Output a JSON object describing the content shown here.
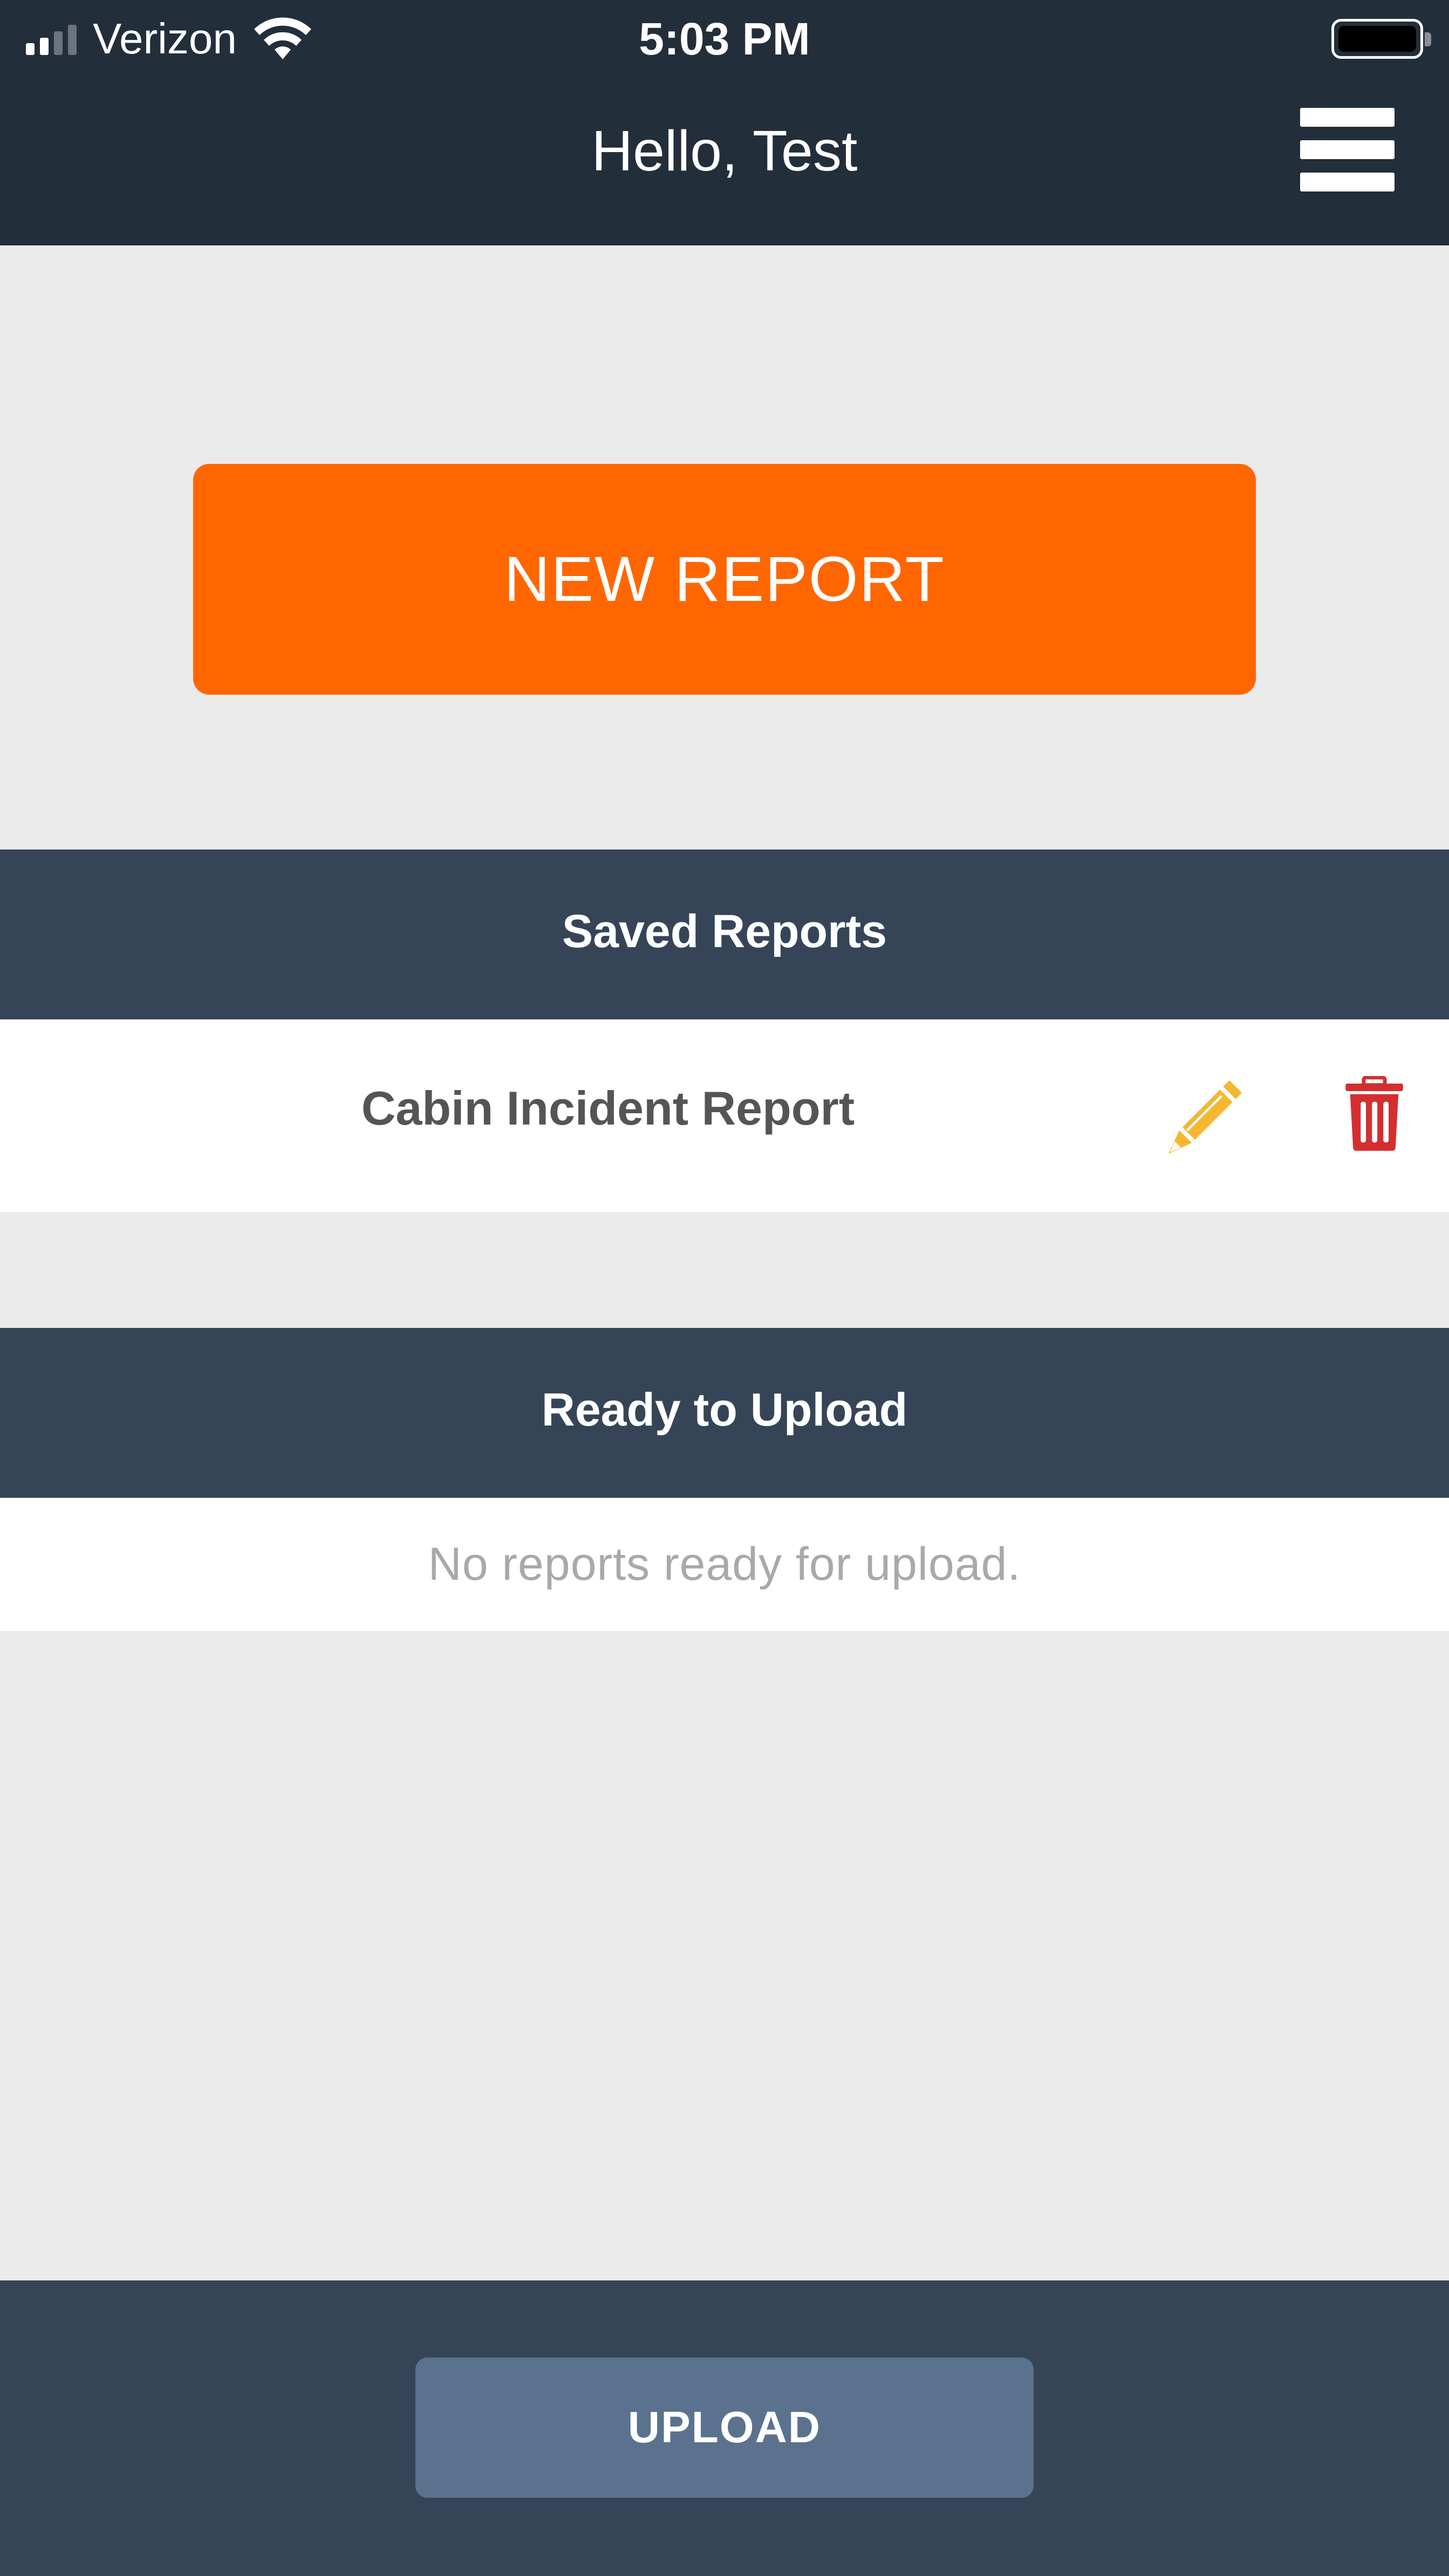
{
  "status_bar": {
    "carrier": "Verizon",
    "time": "5:03 PM"
  },
  "header": {
    "title": "Hello, Test"
  },
  "actions": {
    "new_report_label": "NEW REPORT",
    "upload_label": "UPLOAD"
  },
  "saved_reports": {
    "heading": "Saved Reports",
    "items": [
      {
        "name": "Cabin Incident Report"
      }
    ]
  },
  "ready_to_upload": {
    "heading": "Ready to Upload",
    "empty_message": "No reports ready for upload."
  },
  "colors": {
    "header_bg": "#232e3b",
    "section_bg": "#354557",
    "accent": "#ff6600",
    "edit_icon": "#f5b731",
    "delete_icon": "#d32f2f",
    "upload_button": "#5a728d"
  }
}
